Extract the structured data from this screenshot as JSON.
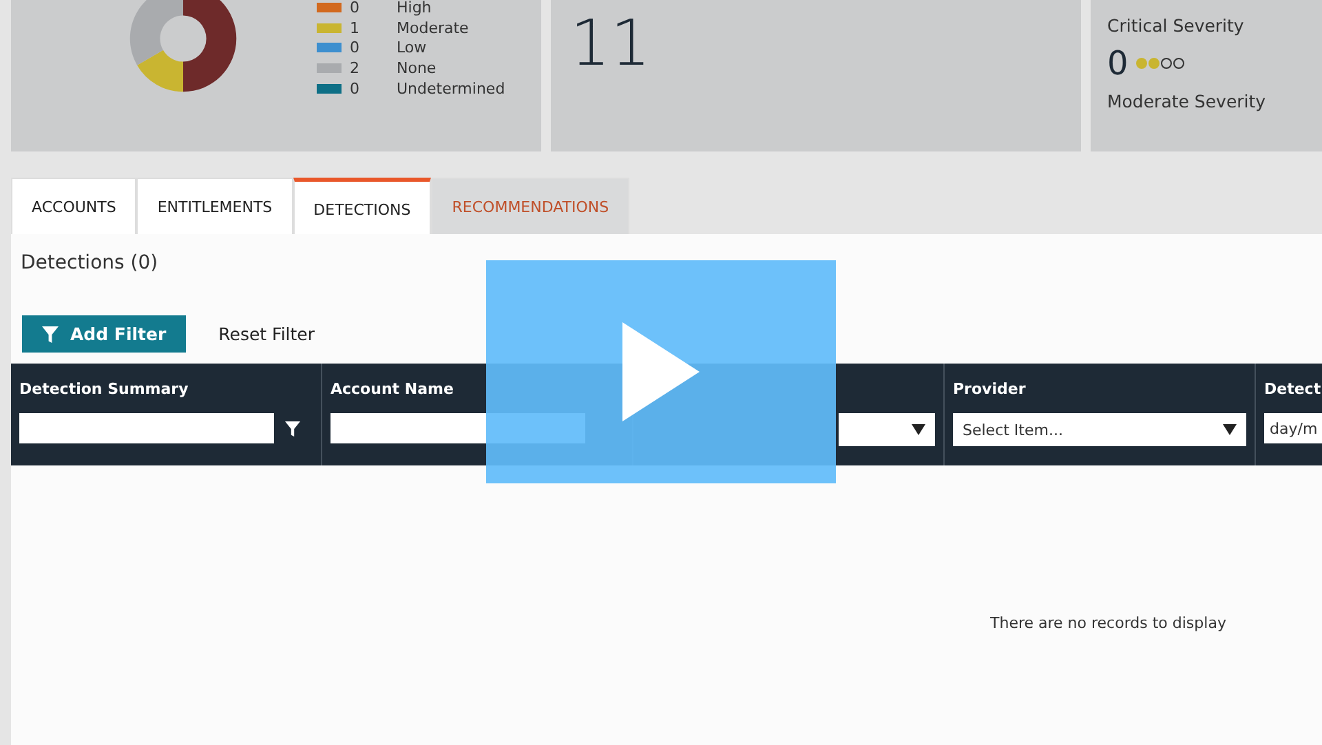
{
  "summary": {
    "legend": [
      {
        "count": "0",
        "label": "High",
        "color": "#d2691e"
      },
      {
        "count": "1",
        "label": "Moderate",
        "color": "#c9b531"
      },
      {
        "count": "0",
        "label": "Low",
        "color": "#3d8fcf"
      },
      {
        "count": "2",
        "label": "None",
        "color": "#a9abae"
      },
      {
        "count": "0",
        "label": "Undetermined",
        "color": "#0e6f86"
      }
    ],
    "total": "11",
    "severity": {
      "title": "Critical Severity",
      "count": "0",
      "stars": 2,
      "subtitle": "Moderate Severity"
    }
  },
  "tabs": [
    {
      "label": "ACCOUNTS",
      "selected": false,
      "hovered": false
    },
    {
      "label": "ENTITLEMENTS",
      "selected": false,
      "hovered": false
    },
    {
      "label": "DETECTIONS",
      "selected": true,
      "hovered": false
    },
    {
      "label": "RECOMMENDATIONS",
      "selected": false,
      "hovered": true
    }
  ],
  "panel": {
    "title": "Detections (0)",
    "add_filter": "Add Filter",
    "reset_filter": "Reset Filter"
  },
  "table": {
    "columns": [
      {
        "label": "Detection Summary",
        "kind": "text"
      },
      {
        "label": "Account Name",
        "kind": "text_covered"
      },
      {
        "kind": "select_covered"
      },
      {
        "label": "Provider",
        "kind": "select",
        "placeholder": "Select Item..."
      },
      {
        "label": "Detect",
        "kind": "date",
        "placeholder": "day/m"
      }
    ],
    "empty": "There are no records to display"
  }
}
